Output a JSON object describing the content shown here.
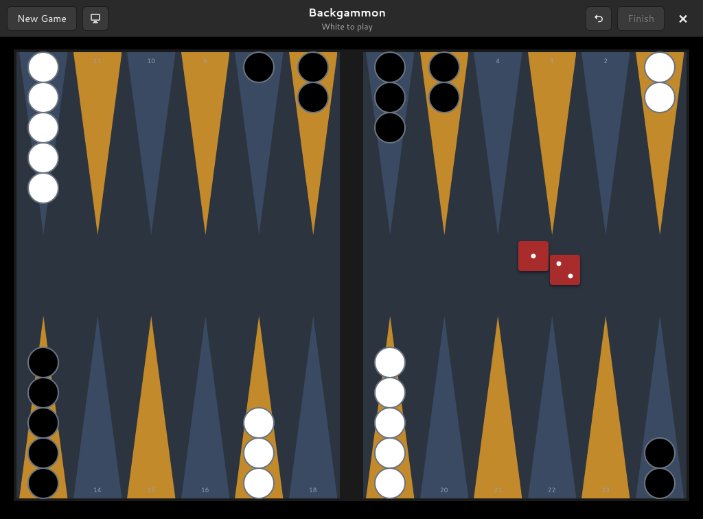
{
  "header": {
    "title": "Backgammon",
    "subtitle": "White to play",
    "new_game_label": "New Game",
    "finish_label": "Finish"
  },
  "colors": {
    "board_bg": "#2c3440",
    "point_a": "#c28a2a",
    "point_b": "#3a4a62",
    "die": "#a82c2c"
  },
  "dice": [
    1,
    2
  ],
  "points_top_left": [
    {
      "pip": 12,
      "checkers": "white",
      "count": 5
    },
    {
      "pip": 11,
      "checkers": null,
      "count": 0
    },
    {
      "pip": 10,
      "checkers": null,
      "count": 0
    },
    {
      "pip": 9,
      "checkers": null,
      "count": 0
    },
    {
      "pip": 8,
      "checkers": "black",
      "count": 1
    },
    {
      "pip": 7,
      "checkers": "black",
      "count": 2
    }
  ],
  "points_top_right": [
    {
      "pip": 6,
      "checkers": "black",
      "count": 3
    },
    {
      "pip": 5,
      "checkers": "black",
      "count": 2
    },
    {
      "pip": 4,
      "checkers": null,
      "count": 0
    },
    {
      "pip": 3,
      "checkers": null,
      "count": 0
    },
    {
      "pip": 2,
      "checkers": null,
      "count": 0
    },
    {
      "pip": 1,
      "checkers": "white",
      "count": 2
    }
  ],
  "points_bottom_left": [
    {
      "pip": 13,
      "checkers": "black",
      "count": 5
    },
    {
      "pip": 14,
      "checkers": null,
      "count": 0
    },
    {
      "pip": 15,
      "checkers": null,
      "count": 0
    },
    {
      "pip": 16,
      "checkers": null,
      "count": 0
    },
    {
      "pip": 17,
      "checkers": "white",
      "count": 3
    },
    {
      "pip": 18,
      "checkers": null,
      "count": 0
    }
  ],
  "points_bottom_right": [
    {
      "pip": 19,
      "checkers": "white",
      "count": 5
    },
    {
      "pip": 20,
      "checkers": null,
      "count": 0
    },
    {
      "pip": 21,
      "checkers": null,
      "count": 0
    },
    {
      "pip": 22,
      "checkers": null,
      "count": 0
    },
    {
      "pip": 23,
      "checkers": null,
      "count": 0
    },
    {
      "pip": 24,
      "checkers": "black",
      "count": 2
    }
  ]
}
